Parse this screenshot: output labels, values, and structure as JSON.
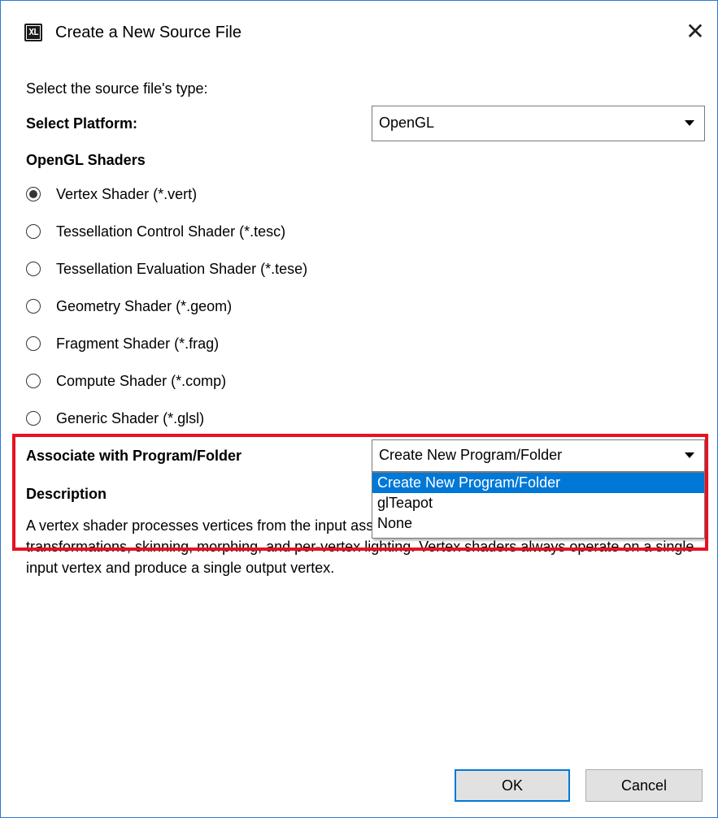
{
  "window": {
    "title": "Create a New Source File",
    "icon_text": "XL",
    "close_glyph": "✕"
  },
  "instructions": "Select the source file's type:",
  "platform": {
    "label": "Select Platform:",
    "value": "OpenGL"
  },
  "shaders": {
    "heading": "OpenGL Shaders",
    "options": [
      {
        "label": "Vertex Shader (*.vert)",
        "checked": true
      },
      {
        "label": "Tessellation Control Shader (*.tesc)",
        "checked": false
      },
      {
        "label": "Tessellation Evaluation Shader (*.tese)",
        "checked": false
      },
      {
        "label": "Geometry Shader (*.geom)",
        "checked": false
      },
      {
        "label": "Fragment Shader (*.frag)",
        "checked": false
      },
      {
        "label": "Compute Shader (*.comp)",
        "checked": false
      },
      {
        "label": "Generic Shader (*.glsl)",
        "checked": false
      }
    ]
  },
  "associate": {
    "label": "Associate with Program/Folder",
    "value": "Create New Program/Folder",
    "options": [
      "Create New Program/Folder",
      "glTeapot",
      "None"
    ],
    "selected_index": 0
  },
  "description": {
    "heading": "Description",
    "text": "A vertex shader processes vertices from the input assembler, performing per-vertex operations such as transformations, skinning, morphing, and per-vertex lighting. Vertex shaders always operate on a single input vertex and produce a single output vertex."
  },
  "buttons": {
    "ok": "OK",
    "cancel": "Cancel"
  },
  "colors": {
    "accent": "#0078d7",
    "highlight_border": "#e81123",
    "window_border": "#2b79d6"
  }
}
